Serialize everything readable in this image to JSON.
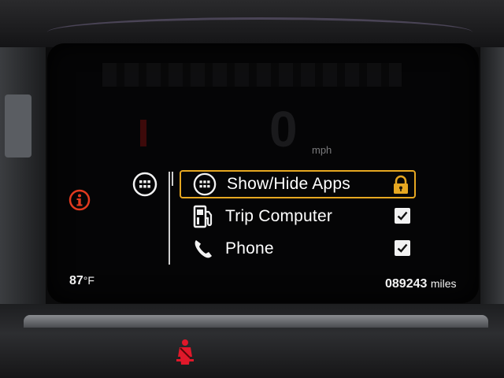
{
  "menu": {
    "items": [
      {
        "label": "Show/Hide Apps",
        "icon": "apps-grid-icon",
        "status": "lock-icon",
        "selected": true
      },
      {
        "label": "Trip Computer",
        "icon": "fuel-pump-icon",
        "status": "checked",
        "selected": false
      },
      {
        "label": "Phone",
        "icon": "phone-icon",
        "status": "checked",
        "selected": false
      }
    ],
    "highlight_color": "#e6a721"
  },
  "status": {
    "temperature_value": "87",
    "temperature_unit": "°F",
    "odometer_value": "089243",
    "odometer_unit": "miles"
  },
  "speedometer": {
    "value": "0",
    "unit": "mph"
  },
  "warnings": {
    "info_icon": "info-icon",
    "info_color": "#e23a1f",
    "seatbelt_icon": "seatbelt-warning-icon",
    "seatbelt_color": "#e0182a"
  }
}
